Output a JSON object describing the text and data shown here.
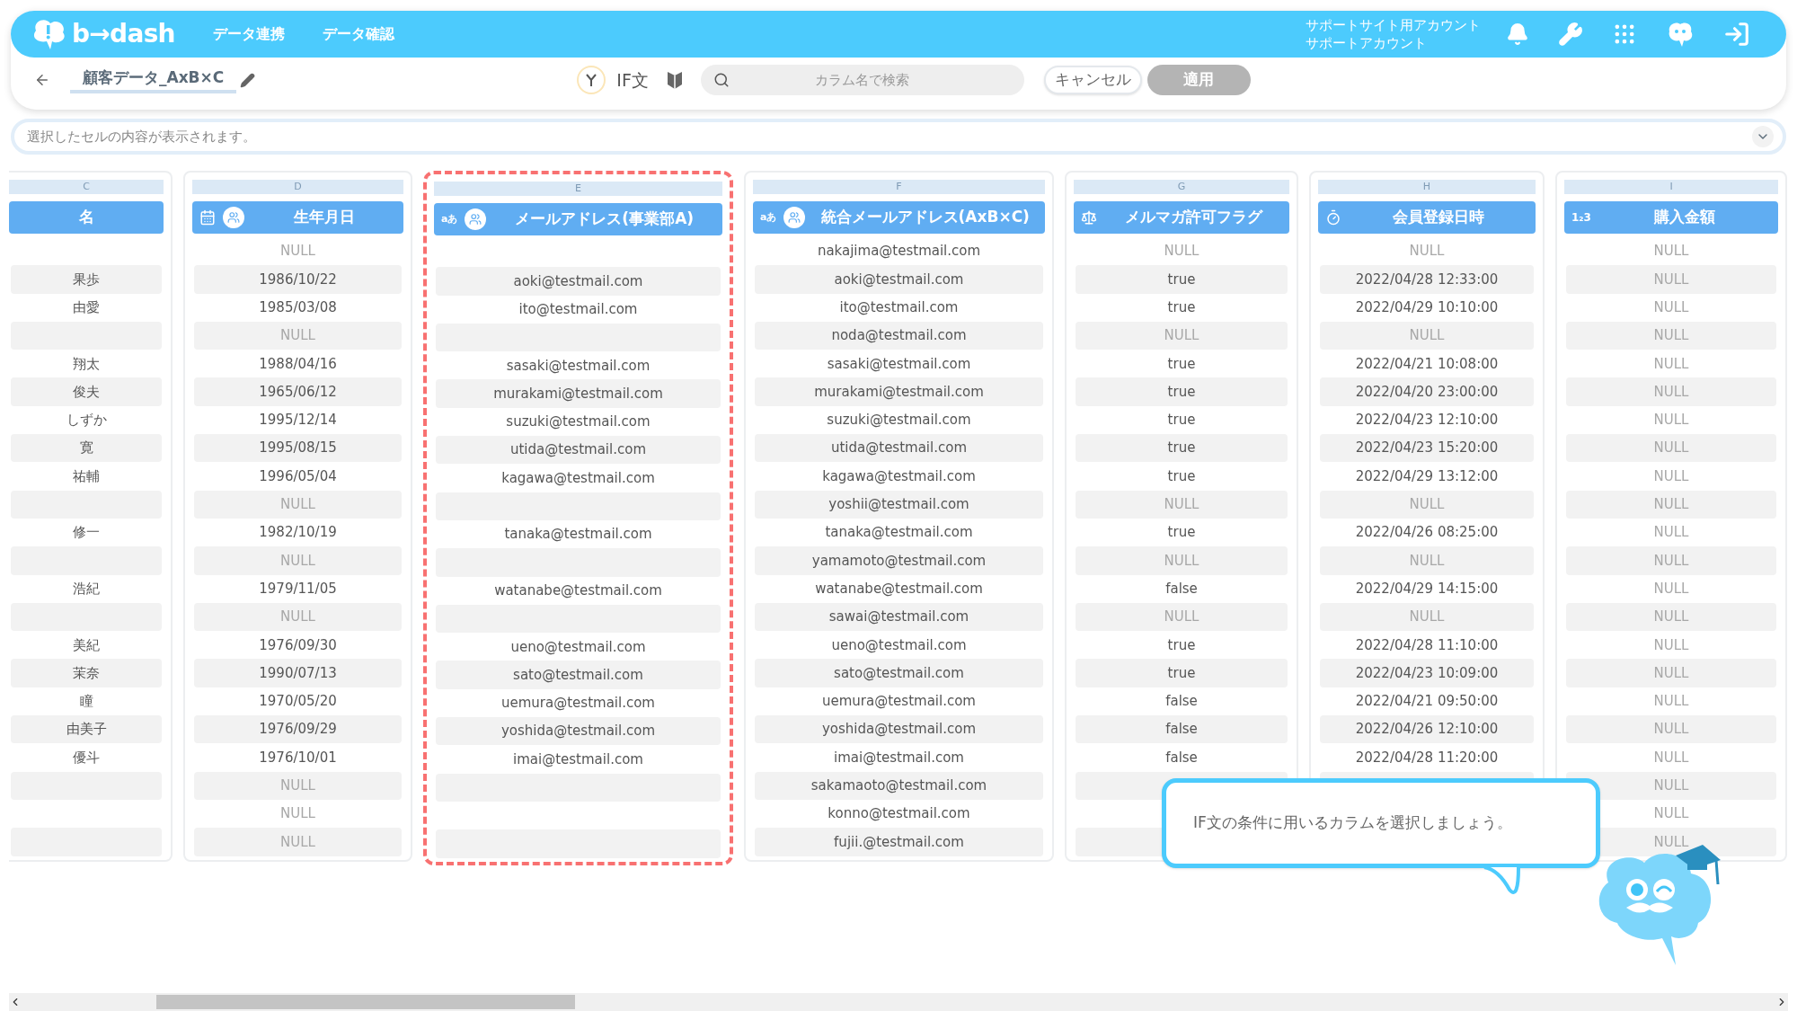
{
  "header": {
    "logo": "b→dash",
    "nav": [
      "データ連携",
      "データ確認"
    ],
    "account": [
      "サポートサイト用アカウント",
      "サポートアカウント"
    ]
  },
  "toolbar": {
    "title": "顧客データ_AxB×C",
    "mode": "IF文",
    "search": {
      "placeholder": "カラム名で検索"
    },
    "cancel": "キャンセル",
    "apply": {
      "label": "適用",
      "disabled": true
    }
  },
  "cell_preview": {
    "placeholder": "選択したセルの内容が表示されます。"
  },
  "table": {
    "columns": [
      {
        "letter": "C",
        "title": "名",
        "kind": "none",
        "group": false,
        "highlighted": false,
        "cells": [
          null,
          "果歩",
          "由愛",
          null,
          "翔太",
          "俊夫",
          "しずか",
          "寛",
          "祐輔",
          null,
          "修一",
          null,
          "浩紀",
          null,
          "美紀",
          "茉奈",
          "瞳",
          "由美子",
          "優斗",
          null,
          null,
          null
        ]
      },
      {
        "letter": "D",
        "title": "生年月日",
        "kind": "date",
        "group": true,
        "highlighted": false,
        "cells": [
          {
            "null": "NULL"
          },
          "1986/10/22",
          "1985/03/08",
          {
            "null": "NULL"
          },
          "1988/04/16",
          "1965/06/12",
          "1995/12/14",
          "1995/08/15",
          "1996/05/04",
          {
            "null": "NULL"
          },
          "1982/10/19",
          {
            "null": "NULL"
          },
          "1979/11/05",
          {
            "null": "NULL"
          },
          "1976/09/30",
          "1990/07/13",
          "1970/05/20",
          "1976/09/29",
          "1976/10/01",
          {
            "null": "NULL"
          },
          {
            "null": "NULL"
          },
          {
            "null": "NULL"
          }
        ]
      },
      {
        "letter": "E",
        "title": "メールアドレス(事業部A)",
        "kind": "text",
        "type_label": "aあ",
        "group": true,
        "highlighted": true,
        "cells": [
          null,
          "aoki@testmail.com",
          "ito@testmail.com",
          null,
          "sasaki@testmail.com",
          "murakami@testmail.com",
          "suzuki@testmail.com",
          "utida@testmail.com",
          "kagawa@testmail.com",
          null,
          "tanaka@testmail.com",
          null,
          "watanabe@testmail.com",
          null,
          "ueno@testmail.com",
          "sato@testmail.com",
          "uemura@testmail.com",
          "yoshida@testmail.com",
          "imai@testmail.com",
          null,
          null,
          null
        ]
      },
      {
        "letter": "F",
        "title": "統合メールアドレス(AxB×C)",
        "kind": "text",
        "type_label": "aあ",
        "group": true,
        "highlighted": false,
        "cells": [
          "nakajima@testmail.com",
          "aoki@testmail.com",
          "ito@testmail.com",
          "noda@testmail.com",
          "sasaki@testmail.com",
          "murakami@testmail.com",
          "suzuki@testmail.com",
          "utida@testmail.com",
          "kagawa@testmail.com",
          "yoshii@testmail.com",
          "tanaka@testmail.com",
          "yamamoto@testmail.com",
          "watanabe@testmail.com",
          "sawai@testmail.com",
          "ueno@testmail.com",
          "sato@testmail.com",
          "uemura@testmail.com",
          "yoshida@testmail.com",
          "imai@testmail.com",
          "sakamaoto@testmail.com",
          "konno@testmail.com",
          "fujii.@testmail.com"
        ]
      },
      {
        "letter": "G",
        "title": "メルマガ許可フラグ",
        "kind": "boolean",
        "group": false,
        "highlighted": false,
        "cells": [
          {
            "null": "NULL"
          },
          "true",
          "true",
          {
            "null": "NULL"
          },
          "true",
          "true",
          "true",
          "true",
          "true",
          {
            "null": "NULL"
          },
          "true",
          {
            "null": "NULL"
          },
          "false",
          {
            "null": "NULL"
          },
          "true",
          "true",
          "false",
          "false",
          "false",
          null,
          null,
          null
        ]
      },
      {
        "letter": "H",
        "title": "会員登録日時",
        "kind": "datetime",
        "group": false,
        "highlighted": false,
        "cells": [
          {
            "null": "NULL"
          },
          "2022/04/28 12:33:00",
          "2022/04/29 10:10:00",
          {
            "null": "NULL"
          },
          "2022/04/21 10:08:00",
          "2022/04/20 23:00:00",
          "2022/04/23 12:10:00",
          "2022/04/23 15:20:00",
          "2022/04/29 13:12:00",
          {
            "null": "NULL"
          },
          "2022/04/26 08:25:00",
          {
            "null": "NULL"
          },
          "2022/04/29 14:15:00",
          {
            "null": "NULL"
          },
          "2022/04/28 11:10:00",
          "2022/04/23 10:09:00",
          "2022/04/21 09:50:00",
          "2022/04/26 12:10:00",
          "2022/04/28 11:20:00",
          null,
          null,
          null
        ]
      },
      {
        "letter": "I",
        "title": "購入金額",
        "kind": "number",
        "type_label": "1₂3",
        "group": false,
        "highlighted": false,
        "cells": [
          {
            "null": "NULL"
          },
          {
            "null": "NULL"
          },
          {
            "null": "NULL"
          },
          {
            "null": "NULL"
          },
          {
            "null": "NULL"
          },
          {
            "null": "NULL"
          },
          {
            "null": "NULL"
          },
          {
            "null": "NULL"
          },
          {
            "null": "NULL"
          },
          {
            "null": "NULL"
          },
          {
            "null": "NULL"
          },
          {
            "null": "NULL"
          },
          {
            "null": "NULL"
          },
          {
            "null": "NULL"
          },
          {
            "null": "NULL"
          },
          {
            "null": "NULL"
          },
          {
            "null": "NULL"
          },
          {
            "null": "NULL"
          },
          {
            "null": "NULL"
          },
          {
            "null": "NULL"
          },
          {
            "null": "NULL"
          },
          {
            "null": "NULL"
          }
        ]
      }
    ]
  },
  "tooltip": {
    "text": "IF文の条件に用いるカラムを選択しましょう。"
  }
}
